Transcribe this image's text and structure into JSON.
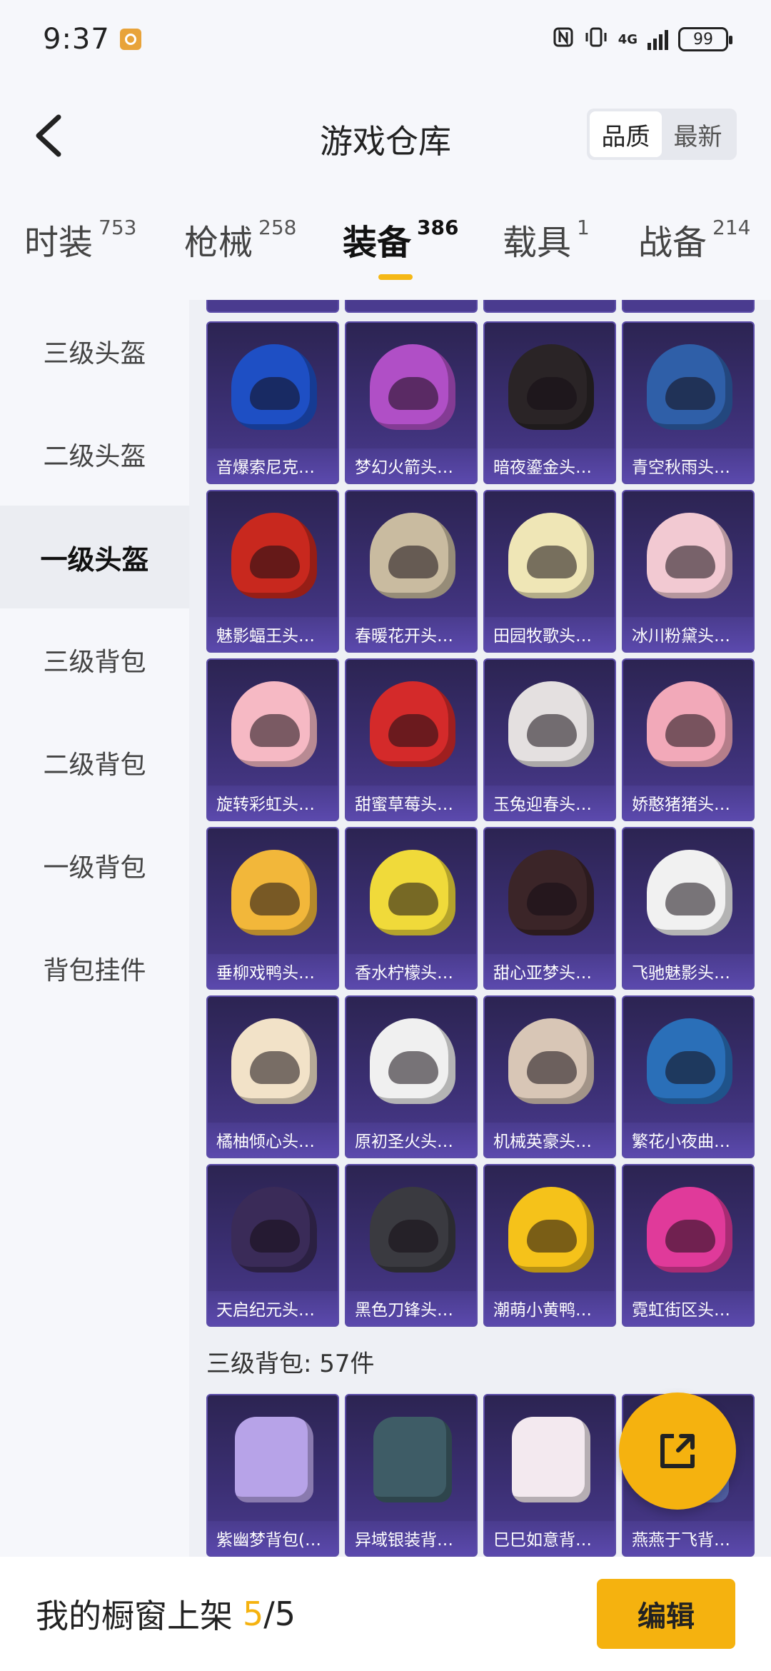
{
  "status_bar": {
    "time": "9:37",
    "network": "4G",
    "battery": "99"
  },
  "header": {
    "title": "游戏仓库",
    "sort_options": [
      "品质",
      "最新"
    ],
    "selected_sort": "品质"
  },
  "tabs": [
    {
      "label": "时装",
      "count": "753",
      "active": false
    },
    {
      "label": "枪械",
      "count": "258",
      "active": false
    },
    {
      "label": "装备",
      "count": "386",
      "active": true
    },
    {
      "label": "载具",
      "count": "1",
      "active": false
    },
    {
      "label": "战备",
      "count": "214",
      "active": false
    }
  ],
  "sidebar": {
    "items": [
      {
        "label": "三级头盔",
        "active": false
      },
      {
        "label": "二级头盔",
        "active": false
      },
      {
        "label": "一级头盔",
        "active": true
      },
      {
        "label": "三级背包",
        "active": false
      },
      {
        "label": "二级背包",
        "active": false
      },
      {
        "label": "一级背包",
        "active": false
      },
      {
        "label": "背包挂件",
        "active": false
      }
    ]
  },
  "helmets": [
    {
      "name": "音爆索尼克…",
      "color": "#1e4fc4"
    },
    {
      "name": "梦幻火箭头…",
      "color": "#b04fc6"
    },
    {
      "name": "暗夜鎏金头…",
      "color": "#2a2426"
    },
    {
      "name": "青空秋雨头…",
      "color": "#2f5fa8"
    },
    {
      "name": "魅影蝠王头…",
      "color": "#c8281e"
    },
    {
      "name": "春暖花开头…",
      "color": "#c9bba0"
    },
    {
      "name": "田园牧歌头…",
      "color": "#efe6b6"
    },
    {
      "name": "冰川粉黛头…",
      "color": "#f2c9d2"
    },
    {
      "name": "旋转彩虹头…",
      "color": "#f6b9c4"
    },
    {
      "name": "甜蜜草莓头…",
      "color": "#d42a2a"
    },
    {
      "name": "玉兔迎春头…",
      "color": "#e4e0e0"
    },
    {
      "name": "娇憨猪猪头…",
      "color": "#f2a9b9"
    },
    {
      "name": "垂柳戏鸭头…",
      "color": "#f2b73a"
    },
    {
      "name": "香水柠檬头…",
      "color": "#f0da3a"
    },
    {
      "name": "甜心亚梦头…",
      "color": "#3b2528"
    },
    {
      "name": "飞驰魅影头…",
      "color": "#f1f1f1"
    },
    {
      "name": "橘柚倾心头…",
      "color": "#f2e2c8"
    },
    {
      "name": "原初圣火头…",
      "color": "#f0f0f0"
    },
    {
      "name": "机械英豪头…",
      "color": "#d8c6b6"
    },
    {
      "name": "繁花小夜曲…",
      "color": "#2a6fb8"
    },
    {
      "name": "天启纪元头…",
      "color": "#3a2b58"
    },
    {
      "name": "黑色刀锋头…",
      "color": "#3a3a40"
    },
    {
      "name": "潮萌小黄鸭…",
      "color": "#f5c21a"
    },
    {
      "name": "霓虹街区头…",
      "color": "#e03a9a"
    }
  ],
  "section": {
    "title": "三级背包: 57件"
  },
  "backpacks": [
    {
      "name": "紫幽梦背包(…",
      "color": "#b7a3e8"
    },
    {
      "name": "异域银装背…",
      "color": "#3e5c66"
    },
    {
      "name": "巳巳如意背…",
      "color": "#f3e9ef"
    },
    {
      "name": "燕燕于飞背…",
      "color": "#6b7fd8"
    }
  ],
  "bottom_bar": {
    "label": "我的橱窗上架",
    "count": "5",
    "separator": "/",
    "total": "5",
    "edit_label": "编辑"
  },
  "colors": {
    "accent": "#f5b20f",
    "card_bg": "#3b2f73"
  }
}
